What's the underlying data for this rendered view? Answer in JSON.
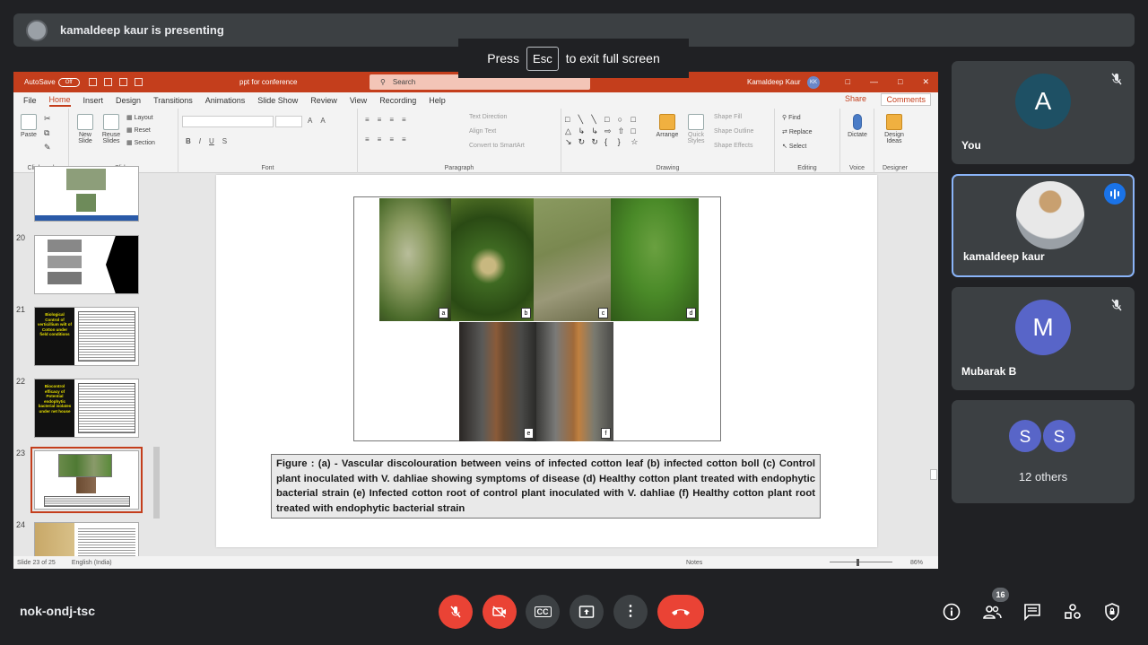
{
  "top_bar": {
    "presenter_text": "kamaldeep kaur is presenting"
  },
  "fullscreen_toast": {
    "press": "Press",
    "key": "Esc",
    "suffix": "to exit full screen"
  },
  "powerpoint": {
    "autosave": "AutoSave",
    "autosave_state": "Off",
    "doc_title": "ppt for conference",
    "search_placeholder": "Search",
    "user": "Kamaldeep Kaur",
    "user_initials": "KK",
    "tabs": [
      "File",
      "Home",
      "Insert",
      "Design",
      "Transitions",
      "Animations",
      "Slide Show",
      "Review",
      "View",
      "Recording",
      "Help"
    ],
    "active_tab": "Home",
    "share": "Share",
    "comments": "Comments",
    "ribbon": {
      "clipboard": {
        "label": "Clipboard",
        "paste": "Paste"
      },
      "slides": {
        "label": "Slides",
        "new_slide": "New Slide",
        "reuse_slides": "Reuse Slides",
        "layout": "Layout",
        "reset": "Reset",
        "section": "Section"
      },
      "font": {
        "label": "Font",
        "grow": "A",
        "shrink": "A",
        "bold": "B",
        "italic": "I",
        "underline": "U",
        "strike": "S"
      },
      "paragraph": {
        "label": "Paragraph",
        "text_direction": "Text Direction",
        "align_text": "Align Text",
        "smartart": "Convert to SmartArt"
      },
      "drawing": {
        "label": "Drawing",
        "arrange": "Arrange",
        "quick_styles": "Quick Styles",
        "shape_fill": "Shape Fill",
        "shape_outline": "Shape Outline",
        "shape_effects": "Shape Effects"
      },
      "editing": {
        "label": "Editing",
        "find": "Find",
        "replace": "Replace",
        "select": "Select"
      },
      "voice": {
        "label": "Voice",
        "dictate": "Dictate"
      },
      "designer": {
        "label": "Designer",
        "design_ideas": "Design Ideas"
      }
    },
    "thumbnails": [
      {
        "num": "20"
      },
      {
        "num": "21",
        "text": "Biological Control of verticillium wilt of Cotton under field conditions"
      },
      {
        "num": "22",
        "text": "Biocontrol efficacy of Potential endophytic bacterial isolates under net house"
      },
      {
        "num": "23"
      },
      {
        "num": "24"
      }
    ],
    "slide": {
      "photo_labels": [
        "a",
        "b",
        "c",
        "d",
        "e",
        "f"
      ],
      "caption": "Figure : (a) - Vascular discolouration between veins of infected cotton leaf (b) infected cotton boll (c) Control plant inoculated with V. dahliae showing symptoms of disease (d) Healthy cotton plant treated with endophytic bacterial strain (e) Infected cotton root of control plant inoculated with V. dahliae (f) Healthy cotton plant root treated with endophytic bacterial strain"
    },
    "status": {
      "slide_of": "Slide 23 of 25",
      "language": "English (India)",
      "notes": "Notes",
      "zoom": "86%"
    }
  },
  "participants": [
    {
      "initial": "A",
      "name": "You",
      "color": "#1e5064"
    },
    {
      "name": "kamaldeep kaur"
    },
    {
      "initial": "M",
      "name": "Mubarak B",
      "color": "#5865c8"
    }
  ],
  "others": {
    "initials": [
      "S",
      "S"
    ],
    "label": "12 others"
  },
  "bottom": {
    "meeting_code": "nok-ondj-tsc",
    "cc_label": "CC",
    "people_count": "16"
  }
}
